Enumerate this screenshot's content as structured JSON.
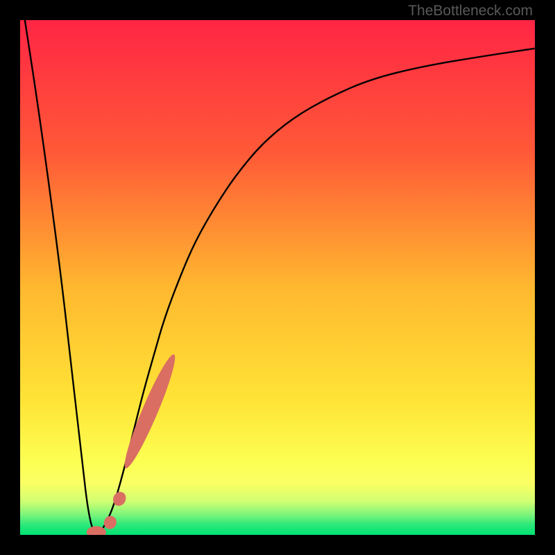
{
  "watermark": "TheBottleneck.com",
  "colors": {
    "frame": "#000000",
    "grad_top": "#ff2544",
    "grad_mid1": "#ff8c2e",
    "grad_mid2": "#ffe436",
    "grad_yellowband": "#fbff64",
    "grad_green": "#00e272",
    "curve": "#000000",
    "marker": "#da6e62"
  },
  "chart_data": {
    "type": "line",
    "title": "",
    "xlabel": "",
    "ylabel": "",
    "xlim": [
      0,
      100
    ],
    "ylim": [
      0,
      100
    ],
    "x": [
      0,
      4,
      8,
      10,
      12,
      13,
      14,
      15,
      16,
      18,
      20,
      22,
      24,
      26,
      28,
      31,
      34,
      38,
      42,
      47,
      53,
      60,
      68,
      78,
      90,
      100
    ],
    "y": [
      106,
      80,
      50,
      32,
      15,
      6,
      1,
      0,
      1,
      5,
      12,
      20,
      28,
      35,
      42,
      50,
      57,
      64,
      70,
      76,
      81,
      85,
      88.5,
      91,
      93,
      94.5
    ],
    "series": [
      {
        "name": "bottleneck-curve",
        "x_key": "x",
        "y_key": "y"
      }
    ],
    "markers": [
      {
        "name": "small-marker-1",
        "cx": 17.5,
        "cy": 2.4,
        "rlong": 1.3,
        "rshort": 1.2,
        "angle": 63
      },
      {
        "name": "small-marker-2",
        "cx": 19.3,
        "cy": 7.0,
        "rlong": 1.4,
        "rshort": 1.2,
        "angle": 63
      },
      {
        "name": "long-marker",
        "cx": 25.2,
        "cy": 24.0,
        "rlong": 12.0,
        "rshort": 1.5,
        "angle": 67
      },
      {
        "name": "bottom-marker",
        "cx": 14.8,
        "cy": 0.5,
        "rlong": 1.9,
        "rshort": 1.2,
        "angle": 0
      }
    ]
  }
}
